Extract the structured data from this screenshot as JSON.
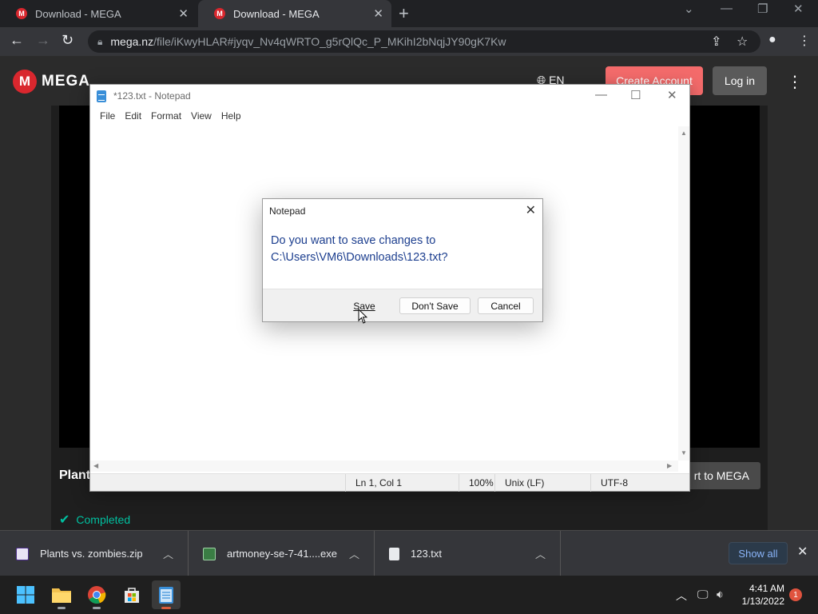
{
  "browser": {
    "tabs": [
      {
        "title": "Download - MEGA"
      },
      {
        "title": "Download - MEGA"
      }
    ],
    "favicon_letter": "M",
    "url_host": "mega.nz",
    "url_path": "/file/iKwyHLAR#jyqv_Nv4qWRTO_g5rQlQc_P_MKihI2bNqjJY90gK7Kw"
  },
  "mega": {
    "logo_letter": "M",
    "logo_text": "MEGA",
    "lang": "EN",
    "create_account": "Create Account",
    "login": "Log in",
    "file_name_partial": "Plants",
    "import_button": "rt to MEGA",
    "status": "Completed"
  },
  "notepad": {
    "title": "*123.txt - Notepad",
    "menu": [
      "File",
      "Edit",
      "Format",
      "View",
      "Help"
    ],
    "status": {
      "position": "Ln 1, Col 1",
      "zoom": "100%",
      "line_ending": "Unix (LF)",
      "encoding": "UTF-8"
    }
  },
  "dialog": {
    "title": "Notepad",
    "message_line1": "Do you want to save changes to",
    "message_line2": "C:\\Users\\VM6\\Downloads\\123.txt?",
    "save": "Save",
    "dont_save": "Don't Save",
    "cancel": "Cancel"
  },
  "downloads": {
    "items": [
      {
        "name": "Plants vs. zombies.zip",
        "icon": "zip-file-icon"
      },
      {
        "name": "artmoney-se-7-41....exe",
        "icon": "exe-file-icon"
      },
      {
        "name": "123.txt",
        "icon": "text-file-icon"
      }
    ],
    "show_all": "Show all"
  },
  "taskbar": {
    "time": "4:41 AM",
    "date": "1/13/2022",
    "notification_count": "1"
  },
  "colors": {
    "mega_red": "#d9272e",
    "create_account_bg": "#f46b6b",
    "dialog_text": "#1d3f8f",
    "completed_green": "#00c0a0"
  }
}
